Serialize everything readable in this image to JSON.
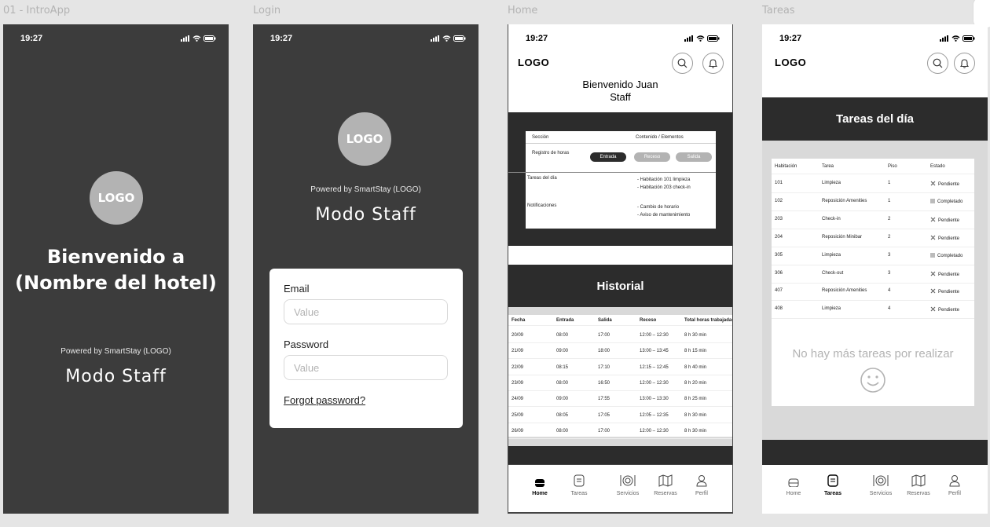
{
  "frames": {
    "intro": {
      "label": "01 - IntroApp"
    },
    "login": {
      "label": "Login"
    },
    "home": {
      "label": "Home"
    },
    "tareas": {
      "label": "Tareas"
    }
  },
  "status": {
    "time": "19:27"
  },
  "logo_text": "LOGO",
  "intro": {
    "welcome_line1": "Bienvenido a",
    "welcome_line2": "(Nombre del hotel)",
    "powered": "Powered by SmartStay (LOGO)",
    "modo": "Modo Staff"
  },
  "login": {
    "powered": "Powered by SmartStay (LOGO)",
    "modo": "Modo Staff",
    "email_label": "Email",
    "email_placeholder": "Value",
    "password_label": "Password",
    "password_placeholder": "Value",
    "forgot": "Forgot password?"
  },
  "home": {
    "header_logo": "LOGO",
    "greeting_line1": "Bienvenido Juan",
    "greeting_line2": "Staff",
    "summary": {
      "col1": "Sección",
      "col2": "Contenido / Elementos",
      "row_registro": "Registro de horas",
      "btn_entrada": "Entrada",
      "btn_receso": "Receso",
      "btn_salida": "Salida",
      "row_tareas": "Tareas del día",
      "tareas_1": "- Habitación 101 limpieza",
      "tareas_2": "- Habitación 203 check-in",
      "row_notif": "Notificaciones",
      "notif_1": "- Cambio de horario",
      "notif_2": "- Aviso de mantenimiento"
    },
    "historial_title": "Historial",
    "historial_headers": [
      "Fecha",
      "Entrada",
      "Salida",
      "Receso",
      "Total horas trabajadas"
    ],
    "historial_rows": [
      [
        "20/09",
        "08:00",
        "17:00",
        "12:00 – 12:30",
        "8 h 30 min"
      ],
      [
        "21/09",
        "09:00",
        "18:00",
        "13:00 – 13:45",
        "8 h 15 min"
      ],
      [
        "22/09",
        "08:15",
        "17:10",
        "12:15 – 12:45",
        "8 h 40 min"
      ],
      [
        "23/09",
        "08:00",
        "16:50",
        "12:00 – 12:30",
        "8 h 20 min"
      ],
      [
        "24/09",
        "09:00",
        "17:55",
        "13:00 – 13:30",
        "8 h 25 min"
      ],
      [
        "25/09",
        "08:05",
        "17:05",
        "12:05 – 12:35",
        "8 h 30 min"
      ],
      [
        "26/09",
        "08:00",
        "17:00",
        "12:00 – 12:30",
        "8 h 30 min"
      ]
    ]
  },
  "tareas": {
    "header_logo": "LOGO",
    "title": "Tareas del día",
    "headers": [
      "Habitación",
      "Tarea",
      "Piso",
      "Estado"
    ],
    "rows": [
      [
        "101",
        "Limpieza",
        "1",
        "Pendiente"
      ],
      [
        "102",
        "Reposición Amenities",
        "1",
        "Completado"
      ],
      [
        "203",
        "Check-in",
        "2",
        "Pendiente"
      ],
      [
        "204",
        "Reposición Minibar",
        "2",
        "Pendiente"
      ],
      [
        "305",
        "Limpieza",
        "3",
        "Completado"
      ],
      [
        "306",
        "Check-out",
        "3",
        "Pendiente"
      ],
      [
        "407",
        "Reposición Amenities",
        "4",
        "Pendiente"
      ],
      [
        "408",
        "Limpieza",
        "4",
        "Pendiente"
      ]
    ],
    "empty_msg": "No hay más tareas por realizar"
  },
  "nav": [
    "Home",
    "Tareas",
    "Servicios",
    "Reservas",
    "Perfil"
  ],
  "colors": {
    "dark_bg": "#3c3c3c",
    "band": "#2c2c2c",
    "logo_gray": "#b3b3b3"
  }
}
